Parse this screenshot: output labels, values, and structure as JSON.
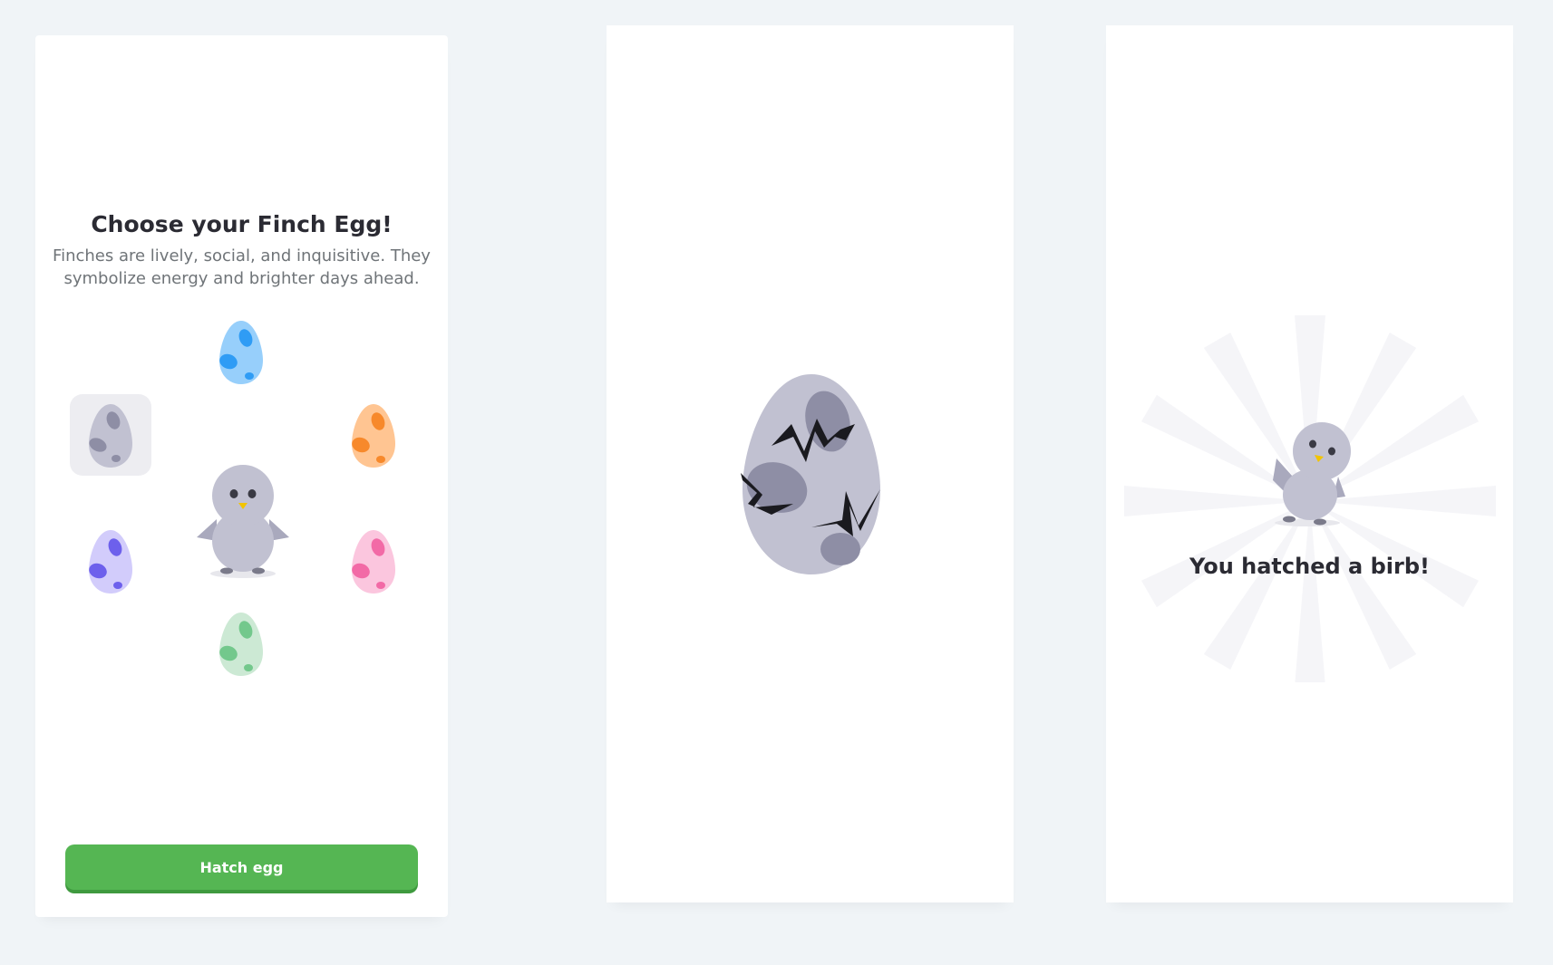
{
  "choose_screen": {
    "title": "Choose your Finch Egg!",
    "subtitle": "Finches are lively, social, and inquisitive. They symbolize energy and brighter days ahead.",
    "eggs": [
      {
        "name": "gray-egg",
        "selected": true,
        "body": "#c1c1d1",
        "spot": "#8e8ea5"
      },
      {
        "name": "blue-egg",
        "selected": false,
        "body": "#97cffb",
        "spot": "#2f9cf5"
      },
      {
        "name": "orange-egg",
        "selected": false,
        "body": "#ffc592",
        "spot": "#f7892b"
      },
      {
        "name": "purple-egg",
        "selected": false,
        "body": "#d2ccfb",
        "spot": "#6d60ec"
      },
      {
        "name": "pink-egg",
        "selected": false,
        "body": "#fbc6de",
        "spot": "#f26aa6"
      },
      {
        "name": "green-egg",
        "selected": false,
        "body": "#cce9d4",
        "spot": "#73c88c"
      }
    ],
    "hatch_button": "Hatch egg"
  },
  "hatching_screen": {
    "egg_body": "#c1c1d1",
    "egg_spot": "#8e8ea5",
    "crack_color": "#1a1a1f"
  },
  "hatched_screen": {
    "message": "You hatched a birb!"
  },
  "colors": {
    "background": "#f0f4f7",
    "panel": "#ffffff",
    "button_green": "#55b653",
    "bird_body": "#c1c1d1",
    "beak": "#f2c400"
  },
  "icons": {
    "egg": "egg-icon",
    "bird": "finch-bird-icon",
    "crack": "crack-lines-icon",
    "sunburst": "sunburst-rays-icon"
  }
}
